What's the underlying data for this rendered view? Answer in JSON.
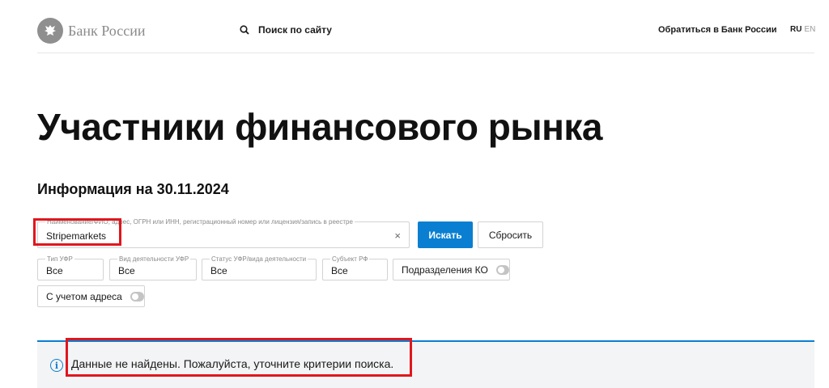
{
  "header": {
    "logo_text": "Банк России",
    "site_search_label": "Поиск по сайту",
    "contact_link": "Обратиться в Банк России",
    "lang_ru": "RU",
    "lang_en": "EN"
  },
  "page": {
    "title": "Участники финансового рынка",
    "info_date": "Информация на 30.11.2024"
  },
  "search": {
    "label": "Наименование/ФИО, адрес, ОГРН или ИНН, регистрационный номер или лицензия/запись в реестре",
    "value": "Stripemarkets",
    "clear_symbol": "×",
    "submit_label": "Искать",
    "reset_label": "Сбросить"
  },
  "filters": [
    {
      "label": "Тип УФР",
      "value": "Все"
    },
    {
      "label": "Вид деятельности УФР",
      "value": "Все"
    },
    {
      "label": "Статус УФР/вида деятельности",
      "value": "Все"
    },
    {
      "label": "Субъект РФ",
      "value": "Все"
    }
  ],
  "toggles": {
    "ko_divisions": {
      "label": "Подразделения КО",
      "on": false
    },
    "with_address": {
      "label": "С учетом адреса",
      "on": false
    }
  },
  "result": {
    "icon": "info-icon",
    "message": "Данные не найдены. Пожалуйста, уточните критерии поиска."
  },
  "colors": {
    "accent": "#0a7fd1",
    "highlight": "#e0161e"
  }
}
